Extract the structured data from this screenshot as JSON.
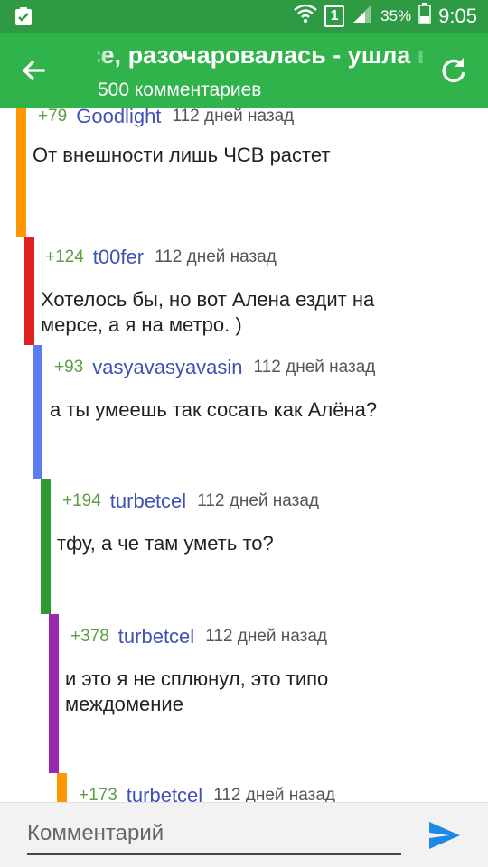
{
  "status_bar": {
    "sim": "1",
    "battery": "35%",
    "time": "9:05"
  },
  "app_bar": {
    "title": "Ой, все, разочаровалась - ушла вниз!!!  Алёна на Мерседесе",
    "subtitle": "500 комментариев"
  },
  "comments": [
    {
      "score": "+79",
      "author": "Goodlight",
      "time": "112 дней назад",
      "text": "От внешности лишь ЧСВ растет",
      "bar_color": "#ff9800"
    },
    {
      "score": "+124",
      "author": "t00fer",
      "time": "112 дней назад",
      "text": "Хотелось бы, но вот Алена ездит на мерсе, а я на метро. )",
      "bar_color": "#e02020"
    },
    {
      "score": "+93",
      "author": "vasyavasyavasin",
      "time": "112 дней назад",
      "text": "а ты умеешь так сосать как Алёна?",
      "bar_color": "#5b7cf0"
    },
    {
      "score": "+194",
      "author": "turbetcel",
      "time": "112 дней назад",
      "text": "тфу, а че там уметь то?",
      "bar_color": "#2e9b30"
    },
    {
      "score": "+378",
      "author": "turbetcel",
      "time": "112 дней назад",
      "text": "и это я не сплюнул, это типо междомение",
      "bar_color": "#9c27b0"
    },
    {
      "score": "+173",
      "author": "turbetcel",
      "time": "112 дней назад",
      "text": "",
      "bar_color": "#ff9800"
    }
  ],
  "input": {
    "placeholder": "Комментарий"
  },
  "icons": {
    "back": "arrow-back-icon",
    "refresh": "refresh-icon",
    "send": "send-icon"
  },
  "colors": {
    "status_bar": "#2e9b44",
    "app_bar": "#2fb34a",
    "score": "#5b9e45",
    "author": "#3f51b5",
    "send": "#1e88e5"
  }
}
